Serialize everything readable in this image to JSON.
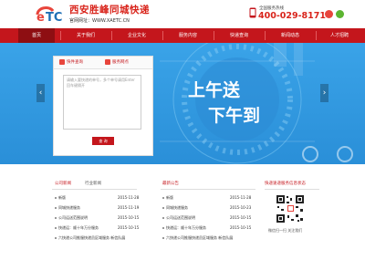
{
  "header": {
    "brand_title": "西安胜峰同城快递",
    "site_label": "官网网址：WWW.XAETC.CN",
    "logo_text": "ETC",
    "hotline_label": "全国服务热线",
    "hotline_number": "400-029-8171"
  },
  "nav": {
    "items": [
      {
        "label": "首页",
        "active": true
      },
      {
        "label": "关于我们"
      },
      {
        "label": "企业文化"
      },
      {
        "label": "服务内容"
      },
      {
        "label": "快递查询"
      },
      {
        "label": "新闻动态"
      },
      {
        "label": "人才招聘"
      }
    ]
  },
  "banner": {
    "headline1": "上午送",
    "headline2": "下午到",
    "track_tabs": [
      "快件查询",
      "服务网点"
    ],
    "track_placeholder": "请输入要快递的单号，多个单号请用Enter回车键隔开",
    "query_button": "查 询"
  },
  "news": {
    "tabs": [
      "公司新闻",
      "行业新闻"
    ],
    "items": [
      {
        "title": "新版",
        "date": "2015-11-28"
      },
      {
        "title": "同城快递服务",
        "date": "2015-11-19"
      },
      {
        "title": "公司运送范围说明",
        "date": "2015-10-15"
      },
      {
        "title": "快递运：顺十年万分服务",
        "date": "2015-10-15"
      },
      {
        "title": "六快递公司推服快递员区域服务 新信队展",
        "date": "2015-10-15"
      }
    ]
  },
  "notice": {
    "title": "最新公告",
    "items": [
      {
        "title": "新版",
        "date": "2015-11-28"
      },
      {
        "title": "同城快递服务",
        "date": "2015-10-23"
      },
      {
        "title": "公司运送范围说明",
        "date": "2015-10-15"
      },
      {
        "title": "快递运：顺十年万分服务",
        "date": "2015-10-15"
      },
      {
        "title": "六快递公司推服快递员区域服务 新信队展",
        "date": "2015-10-15"
      }
    ]
  },
  "wechat": {
    "title": "快递速递服务信息状态",
    "caption": "微信扫一扫 关注我们"
  },
  "colors": {
    "brand_red": "#c4161c",
    "banner_blue": "#2f97de",
    "accent_blue": "#1f6fb5"
  }
}
